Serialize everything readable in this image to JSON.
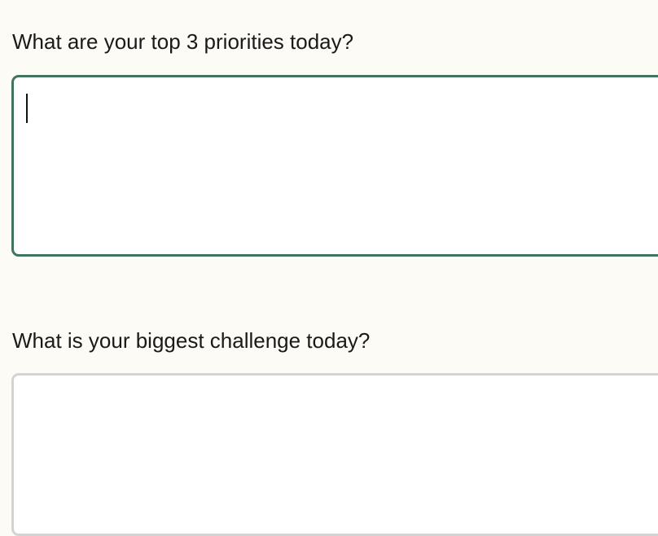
{
  "questions": [
    {
      "label": "What are your top 3 priorities today?",
      "value": "",
      "focused": true
    },
    {
      "label": "What is your biggest challenge today?",
      "value": "",
      "focused": false
    }
  ],
  "colors": {
    "page_background": "#fdfbf6",
    "focused_border": "#3f7560",
    "unfocused_border": "#d3d3d3",
    "text": "#1a1a1a"
  }
}
